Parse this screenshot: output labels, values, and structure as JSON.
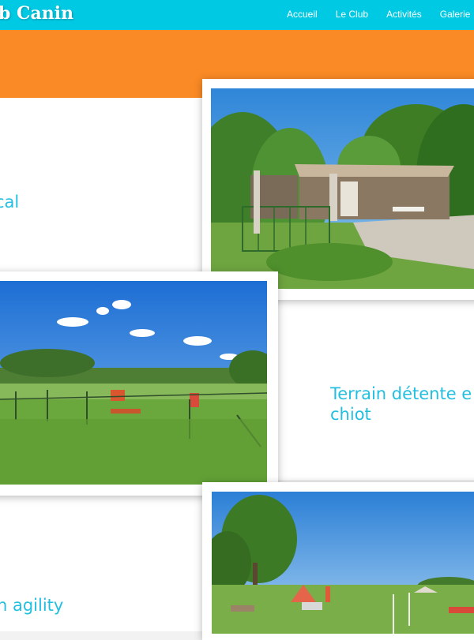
{
  "header": {
    "brand": "ub Canin",
    "nav": [
      "Accueil",
      "Le Club",
      "Activités",
      "Galerie"
    ]
  },
  "sections": [
    {
      "title": "cal"
    },
    {
      "title_line1": "Terrain détente e",
      "title_line2": "chiot"
    },
    {
      "title": "n agility"
    }
  ],
  "colors": {
    "header_bg": "#00c9e3",
    "orange_band": "#fa8a25",
    "title_blue": "#23bfe0"
  }
}
